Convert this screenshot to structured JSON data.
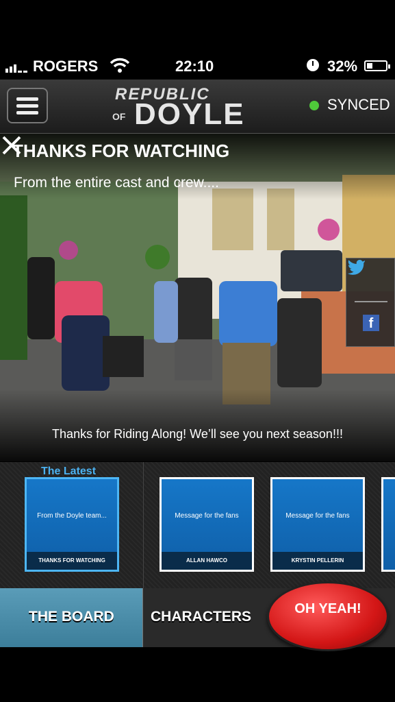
{
  "status_bar": {
    "carrier": "ROGERS",
    "time": "22:10",
    "battery": "32%",
    "battery_level": 0.32
  },
  "header": {
    "logo_top": "REPUBLIC",
    "logo_of": "OF",
    "logo_main": "DOYLE",
    "sync_status": "SYNCED",
    "sync_color": "#4fc93a"
  },
  "hero": {
    "title": "THANKS FOR WATCHING",
    "subtitle": "From the entire cast and crew....",
    "caption": "Thanks for Riding Along! We’ll see you next season!!!"
  },
  "share": {
    "twitter_icon": "twitter-icon",
    "facebook_icon": "facebook-icon",
    "facebook_letter": "f"
  },
  "latest": {
    "label": "The Latest",
    "cards": [
      {
        "title": "From the Doyle team...",
        "footer": "THANKS FOR WATCHING"
      },
      {
        "title": "Message for the fans",
        "footer": "ALLAN HAWCO"
      },
      {
        "title": "Message for the fans",
        "footer": "KRYSTIN PELLERIN"
      }
    ]
  },
  "bottom_bar": {
    "board_label": "THE BOARD",
    "characters_label": "CHARACTERS",
    "button_label": "OH YEAH!"
  },
  "colors": {
    "accent_blue": "#4bb1f0",
    "card_blue": "#1677c8",
    "button_red": "#d31616"
  }
}
